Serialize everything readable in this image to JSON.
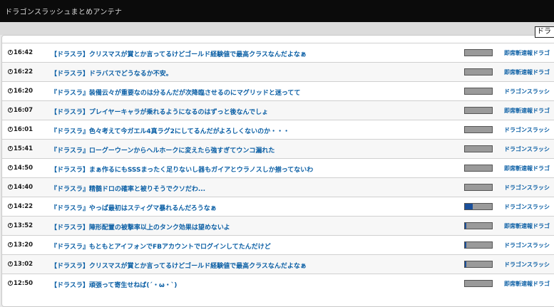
{
  "header": {
    "site_title": "ドラゴンスラッシュまとめアンテナ"
  },
  "search": {
    "value": "ドラ"
  },
  "rows": [
    {
      "time": "16:42",
      "title": "【ドラスラ】クリスマスが賞とか言ってるけどゴールド経験値で最高クラスなんだよなぁ",
      "source": "即席斬速報ドラゴ",
      "meter": 0
    },
    {
      "time": "16:22",
      "title": "【ドラスラ】ドラバスでどうなるか不安。",
      "source": "即席斬速報ドラゴ",
      "meter": 0
    },
    {
      "time": "16:20",
      "title": "『ドラスラ』装備云々が重要なのは分るんだが次降臨させるのにマグリッドと迷ってて",
      "source": "ドラゴンスラッシ",
      "meter": 0
    },
    {
      "time": "16:07",
      "title": "【ドラスラ】プレイヤーキャラが乗れるようになるのはずっと後なんでしょ",
      "source": "即席斬速報ドラゴ",
      "meter": 0
    },
    {
      "time": "16:01",
      "title": "『ドラスラ』色々考えて今ガエル4真ラグ2にしてるんだがよろしくないのか・・・",
      "source": "ドラゴンスラッシ",
      "meter": 0
    },
    {
      "time": "15:41",
      "title": "『ドラスラ』ローグーウーンからヘルホークに変えたら強すぎてウンコ漏れた",
      "source": "ドラゴンスラッシ",
      "meter": 0
    },
    {
      "time": "14:50",
      "title": "【ドラスラ】まぁ作るにもSSSまったく足りないし器もガイアとウラノスしか揃ってないわ",
      "source": "即席斬速報ドラゴ",
      "meter": 0
    },
    {
      "time": "14:40",
      "title": "『ドラスラ』精髄ドロの確率と被りそうでクソだわ...",
      "source": "ドラゴンスラッシ",
      "meter": 0
    },
    {
      "time": "14:22",
      "title": "『ドラスラ』やっぱ最初はスティグマ暴れるんだろうなぁ",
      "source": "ドラゴンスラッシ",
      "meter": 0.28
    },
    {
      "time": "13:52",
      "title": "【ドラスラ】陣形配置の被撃率以上のタンク効果は望めないよ",
      "source": "即席斬速報ドラゴ",
      "meter": 0.05
    },
    {
      "time": "13:20",
      "title": "『ドラスラ』もともとアイフォンでFBアカウントでログインしてたんだけど",
      "source": "ドラゴンスラッシ",
      "meter": 0.05
    },
    {
      "time": "13:02",
      "title": "【ドラスラ】クリスマスが賞とか言ってるけどゴールド経験値で最高クラスなんだよなぁ",
      "source": "ドラゴンスラッシ",
      "meter": 0.05
    },
    {
      "time": "12:50",
      "title": "【ドラスラ】頑張って寄生せねば(´・ω・`)",
      "source": "即席斬速報ドラゴ",
      "meter": 0
    }
  ]
}
